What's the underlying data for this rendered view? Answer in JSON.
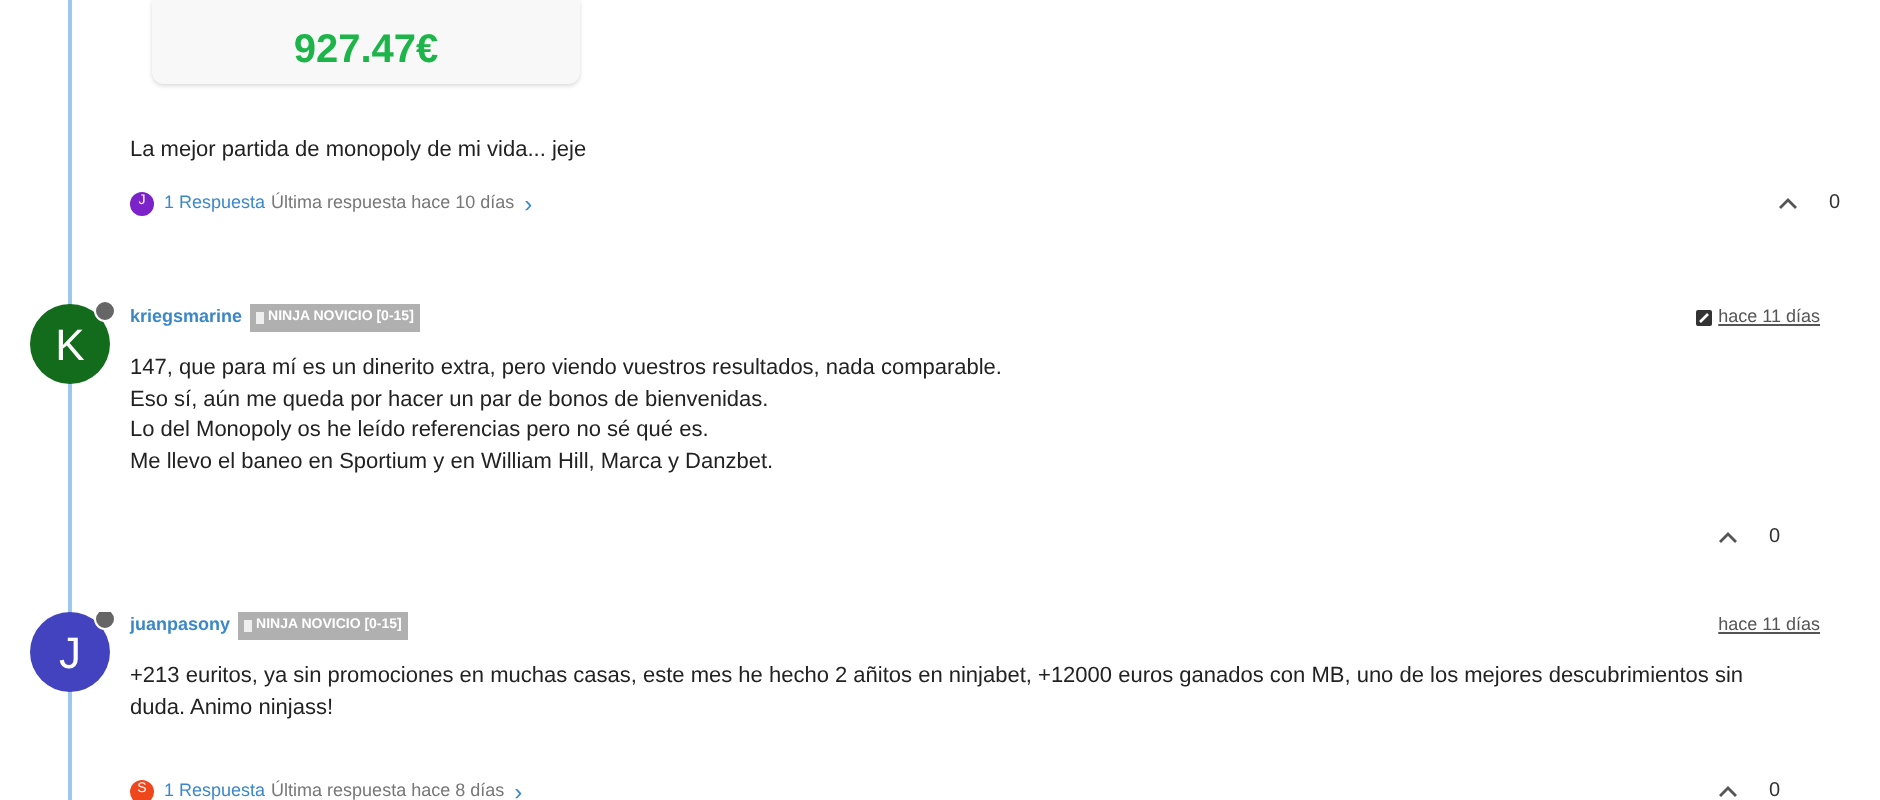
{
  "top_post": {
    "amount": "927.47€",
    "body": "La mejor partida de monopoly de mi vida... jeje",
    "replies": {
      "initial": "J",
      "color": "#7b22c9",
      "count": "1 Respuesta",
      "last": "Última respuesta hace 10 días",
      "chevron": "›"
    },
    "votes": "0"
  },
  "comments": [
    {
      "initial": "K",
      "color": "#136c1b",
      "author": "kriegsmarine",
      "badge": "NINJA NOVICIO [0-15]",
      "edited": true,
      "time": "hace 11 días",
      "lines": [
        "147, que para mí es un dinerito extra, pero viendo vuestros resultados, nada comparable.",
        "Eso sí, aún me queda por hacer un par de bonos de bienvenidas.",
        "Lo del Monopoly os he leído referencias pero no sé qué es.",
        "Me llevo el baneo en Sportium y en William Hill, Marca y Danzbet."
      ],
      "votes": "0"
    },
    {
      "initial": "J",
      "color": "#4343c0",
      "author": "juanpasony",
      "badge": "NINJA NOVICIO [0-15]",
      "edited": false,
      "time": "hace 11 días",
      "lines": [
        "+213 euritos, ya sin promociones en muchas casas, este mes he hecho 2 añitos en ninjabet, +12000 euros ganados con MB, uno de los mejores descubrimientos sin duda. Animo ninjass!"
      ],
      "replies": {
        "initial": "S",
        "color": "#f0461c",
        "count": "1 Respuesta",
        "last": "Última respuesta hace 8 días",
        "chevron": "›"
      },
      "votes": "0"
    }
  ]
}
